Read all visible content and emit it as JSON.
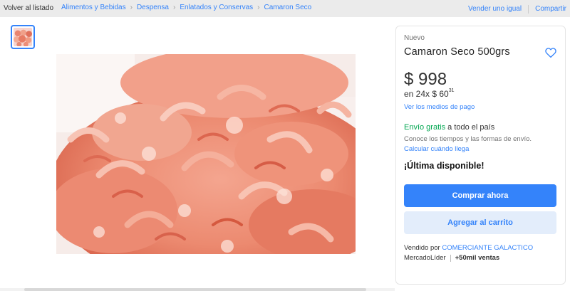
{
  "topbar": {
    "back_label": "Volver al listado",
    "breadcrumbs": [
      "Alimentos y Bebidas",
      "Despensa",
      "Enlatados y Conservas",
      "Camaron Seco"
    ],
    "separator": "›",
    "sell_label": "Vender uno igual",
    "share_label": "Compartir"
  },
  "gallery": {
    "icon": "shrimp-photo"
  },
  "product": {
    "condition": "Nuevo",
    "title": "Camaron Seco 500grs",
    "favorite_icon": "heart-outline-icon",
    "price": "$ 998",
    "installments_prefix": "en 24x $ 60",
    "installments_cents": "31",
    "payment_methods_link": "Ver los medios de pago",
    "shipping_free": "Envío gratis",
    "shipping_rest": " a todo el país",
    "shipping_info": "Conoce los tiempos y las formas de envío.",
    "calc_link": "Calcular cuándo llega",
    "stock_text": "¡Última disponible!",
    "buy_button": "Comprar ahora",
    "cart_button": "Agregar al carrito",
    "seller_prefix": "Vendido por ",
    "seller_name": "COMERCIANTE GALACTICO",
    "reputation": "MercadoLíder",
    "sales": "+50mil ventas"
  },
  "colors": {
    "accent": "#3483fa",
    "free_shipping": "#00a650",
    "background": "#ebebeb"
  }
}
